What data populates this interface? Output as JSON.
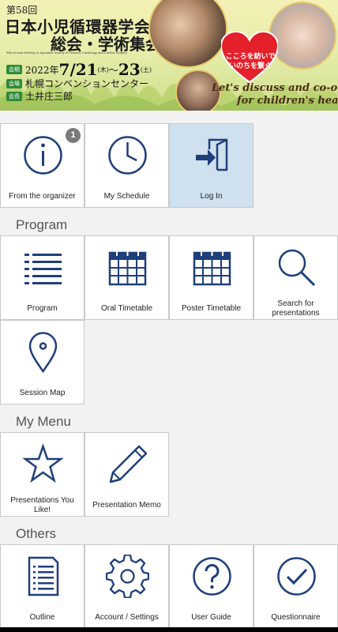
{
  "banner": {
    "edition": "第58回",
    "title_line1": "日本小児循環器学会",
    "title_line2": "総会・学術集会",
    "subtitle_en": "58th Annual Meeting of Japanese Society of Pediatric Cardiology and Cardiac Surgery",
    "date_tag": "会期",
    "date_year": "2022年",
    "date_start": "7/21",
    "date_start_dow": "(木)",
    "date_sep": "～",
    "date_end": "23",
    "date_end_dow": "(土)",
    "venue_tag": "会場",
    "venue": "札幌コンベンションセンター",
    "president_tag": "会長",
    "president": "土井庄三郎",
    "heart_line1": "こころを紡いで",
    "heart_line2": "いのちを繋ぐ",
    "slogan_line1": "Let's discuss and co-operate",
    "slogan_line2": "for children's heart"
  },
  "top_tiles": [
    {
      "label": "From the organizer",
      "icon": "info-icon",
      "badge": "1"
    },
    {
      "label": "My Schedule",
      "icon": "clock-icon"
    },
    {
      "label": "Log In",
      "icon": "login-icon",
      "active": true
    }
  ],
  "sections": {
    "program": "Program",
    "my_menu": "My Menu",
    "others": "Others"
  },
  "program_tiles": [
    {
      "label": "Program",
      "icon": "list-icon"
    },
    {
      "label": "Oral Timetable",
      "icon": "calendar-icon"
    },
    {
      "label": "Poster Timetable",
      "icon": "calendar-icon"
    },
    {
      "label": "Search for presentations",
      "icon": "search-icon"
    },
    {
      "label": "Session Map",
      "icon": "map-pin-icon"
    }
  ],
  "mymenu_tiles": [
    {
      "label": "Presentations You Like!",
      "icon": "star-icon"
    },
    {
      "label": "Presentation Memo",
      "icon": "pencil-icon"
    }
  ],
  "others_tiles": [
    {
      "label": "Outline",
      "icon": "document-icon"
    },
    {
      "label": "Account / Settings",
      "icon": "gear-icon"
    },
    {
      "label": "User Guide",
      "icon": "help-icon"
    },
    {
      "label": "Questionnaire",
      "icon": "check-circle-icon"
    }
  ],
  "colors": {
    "icon": "#1f3f7a",
    "active_tile": "#cfe0ee",
    "badge": "#7a7a7a",
    "section_text": "#555555",
    "heart": "#e4202a"
  }
}
